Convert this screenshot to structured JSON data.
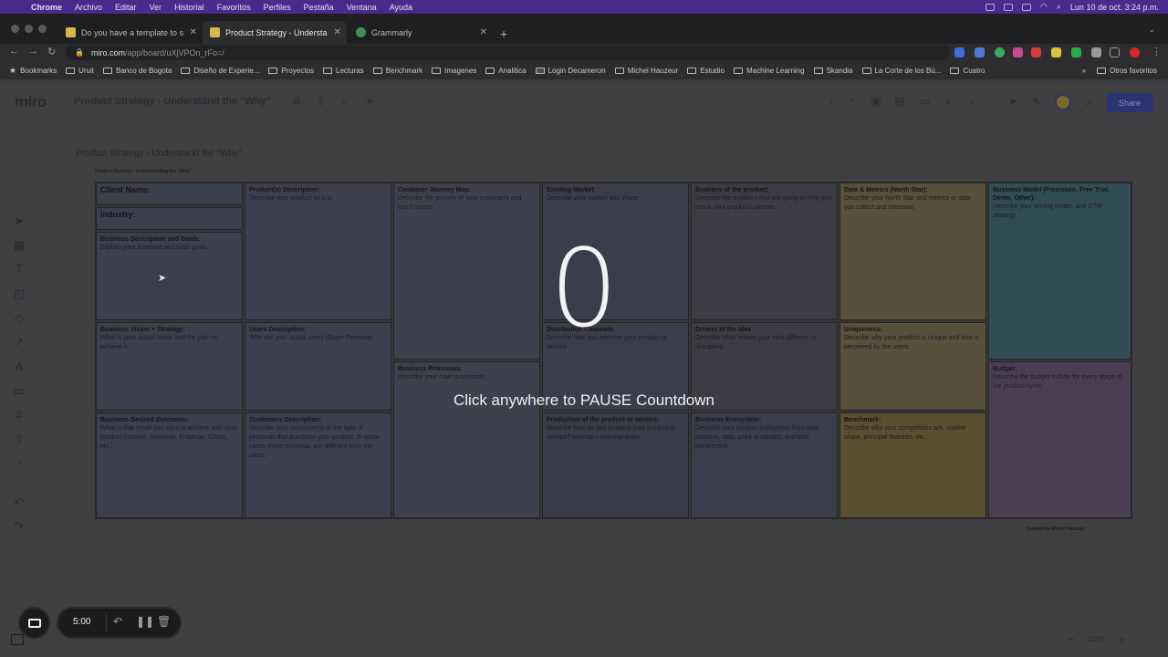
{
  "menubar": {
    "app": "Chrome",
    "items": [
      "Archivo",
      "Editar",
      "Ver",
      "Historial",
      "Favoritos",
      "Perfiles",
      "Pestaña",
      "Ventana",
      "Ayuda"
    ],
    "clock": "Lun 10 de oct. 3:24 p.m."
  },
  "tabs": [
    {
      "label": "Do you have a template to sha"
    },
    {
      "label": "Product Strategy - Understand"
    },
    {
      "label": "Grammarly"
    }
  ],
  "address": {
    "host": "miro.com",
    "path": "/app/board/uXjVPOn_rFo=/"
  },
  "bookmarks": [
    "Bookmarks",
    "Uruit",
    "Banco de Bogota",
    "Diseño de Experie...",
    "Proyectos",
    "Lecturas",
    "Benchmark",
    "Imagenes",
    "Analitica",
    "Login Decameron",
    "Michel Hauzeur",
    "Estudio",
    "Machine Learning",
    "Skandia",
    "La Corte de los Bü...",
    "Cuatro"
  ],
  "bookmarks_more": "»",
  "bookmarks_other": "Otros favoritos",
  "miro": {
    "logo": "miro",
    "board_title": "Product Strategy - Understand the \"Why\"",
    "share": "Share"
  },
  "canvas": {
    "frame_title": "Product Strategy - Understand the \"Why\"",
    "board_heading": "Product Strategy - Understanding the \"Why\"",
    "created_by": "Created by Michel Hauzeur",
    "cells": {
      "client": {
        "h": "Client Name:"
      },
      "industry": {
        "h": "Industry:"
      },
      "goals": {
        "h": "Business Description and Goals:",
        "d": "Explain your business and main goals."
      },
      "product": {
        "h": "Product(s) Description:",
        "d": "Describe your product as it is."
      },
      "journey": {
        "h": "Customer Journey Map:",
        "d": "Describe the journey of your customers and touch points"
      },
      "market": {
        "h": "Existing Market:",
        "d": "Describe your market and share."
      },
      "enablers": {
        "h": "Enablers of the product:",
        "d": "Describe the enablers that are going to help you reach your product outcome."
      },
      "metrics": {
        "h": "Data & Metrics (North Star):",
        "d": "Describe your North Star and metrics or data you collect and measure."
      },
      "model": {
        "h": "Business Model (Freemium, Free Trial, Demo, Other):",
        "d": "Describe your pricing model, and GTM strategy."
      },
      "vision": {
        "h": "Business Vision + Strategy:",
        "d": "What is your actual vision and the plan to achieve it."
      },
      "users": {
        "h": "Users Description:",
        "d": "Who are your actual users (Buyer Persona)."
      },
      "distribution": {
        "h": "Distribution Channels:",
        "d": "Describe how you promote your product or service."
      },
      "drivers": {
        "h": "Drivers of the Idea",
        "d": "Describe what makes your idea different or disruptive."
      },
      "unique": {
        "h": "Uniqueness:",
        "d": "Describe why your product is unique and how is perceived by the users"
      },
      "budget": {
        "h": "Budget:",
        "d": "Describe the budget outline for every stage of the product cycle"
      },
      "processes": {
        "h": "Business Processes:",
        "d": "Describe your main processes."
      },
      "outcomes": {
        "h": "Business Desired Outcomes:",
        "d": "What is that result you want to achieve with your product (Income, Revenue, Engange, Churn, etc.)"
      },
      "customers": {
        "h": "Customers Description:",
        "d": "Describe your customer(s) or the type of personas that purchase your product. In some cases these personas are different from the users."
      },
      "production": {
        "h": "Production of the product or service:",
        "d": "Describe how do you produce your product or service? Internal o external team..."
      },
      "ecosystem": {
        "h": "Business Ecosystem:",
        "d": "Describe your product ecosystem from user, platform, data, point of contact, and tech perspective"
      },
      "benchmark": {
        "h": "Benchmark:",
        "d": "Describe who your competitors are, market share, principal features, etc."
      }
    }
  },
  "countdown": {
    "value": "0",
    "message": "Click anywhere to PAUSE Countdown"
  },
  "timer": {
    "value": "5:00"
  },
  "zoom": {
    "level": "112%"
  },
  "colors": {
    "menubar": "#4a2a8a",
    "share_button": "#2a3470",
    "cell_default": "#3b3f4e",
    "cell_yellow": "#5a4f2e",
    "cell_teal": "#2e4f54",
    "cell_purple": "#4a3f52"
  }
}
